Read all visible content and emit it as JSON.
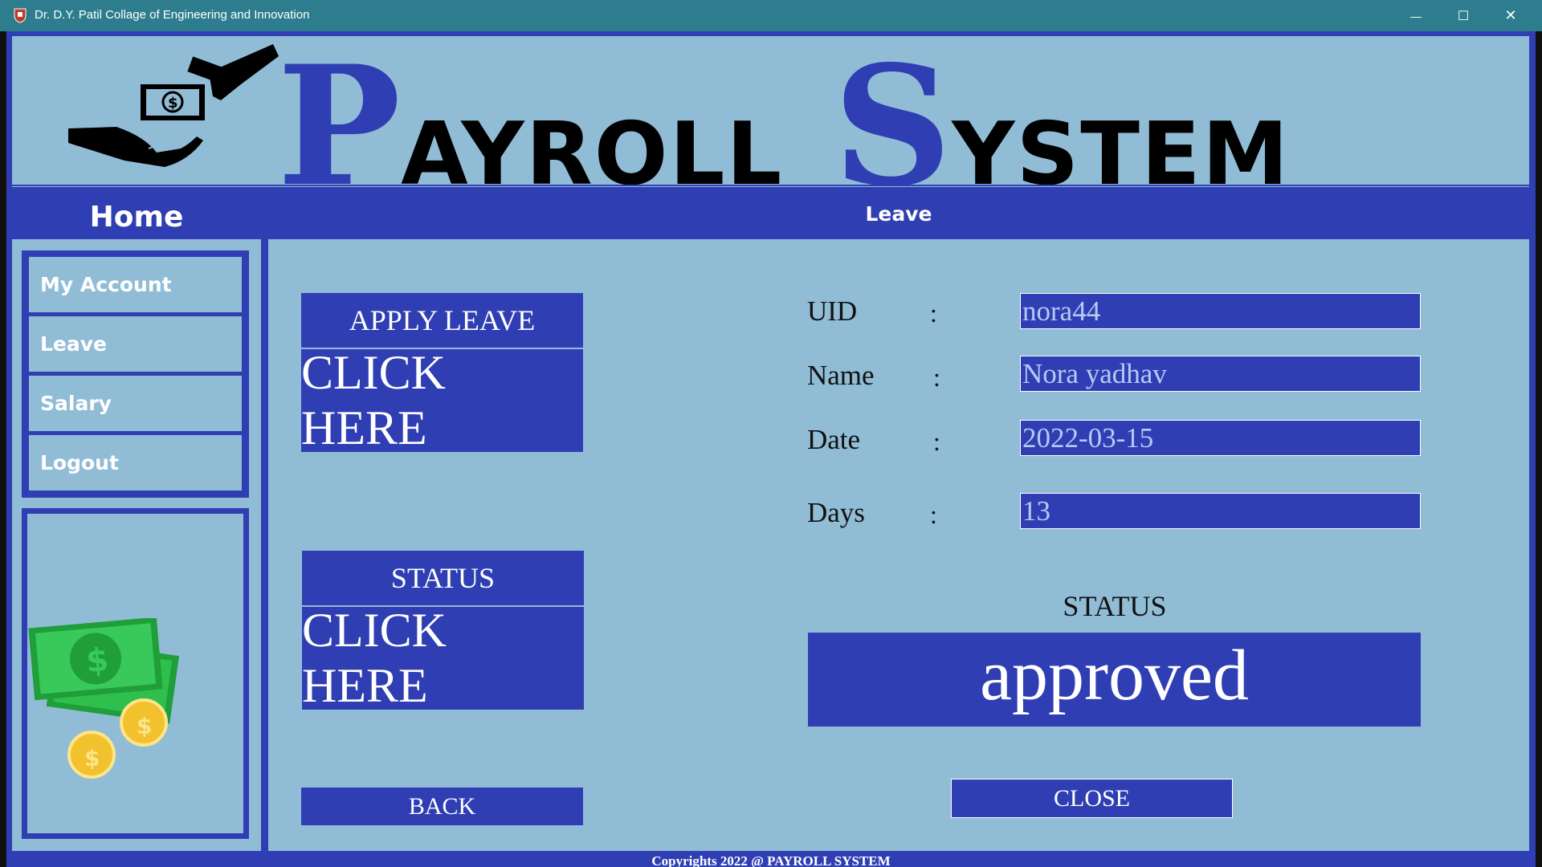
{
  "window": {
    "title": "Dr. D.Y. Patil Collage of Engineering and Innovation",
    "minimize": "—",
    "maximize": "☐",
    "close": "✕"
  },
  "header": {
    "title_p": "P",
    "title_ayroll": "AYROLL",
    "title_s": "S",
    "title_ystem": "YSTEM"
  },
  "sidebar": {
    "heading": "Home",
    "items": [
      {
        "label": "My Account"
      },
      {
        "label": "Leave"
      },
      {
        "label": "Salary"
      },
      {
        "label": "Logout"
      }
    ]
  },
  "main": {
    "heading": "Leave",
    "apply_leave": {
      "title": "APPLY LEAVE",
      "action": "CLICK HERE"
    },
    "status_button": {
      "title": "STATUS",
      "action": "CLICK HERE"
    },
    "back": "BACK",
    "fields": [
      {
        "label": "UID",
        "value": "nora44"
      },
      {
        "label": "Name",
        "value": "Nora yadhav"
      },
      {
        "label": "Date",
        "value": "2022-03-15"
      },
      {
        "label": "Days",
        "value": "13"
      }
    ],
    "colon": ":",
    "status_label": "STATUS",
    "status_value": "approved",
    "close": "CLOSE"
  },
  "footer": {
    "text": "Copyrights 2022 @ PAYROLL SYSTEM"
  },
  "colors": {
    "accent": "#2f3fb3",
    "panel": "#91bcd6",
    "titlebar": "#2d7d8e"
  }
}
